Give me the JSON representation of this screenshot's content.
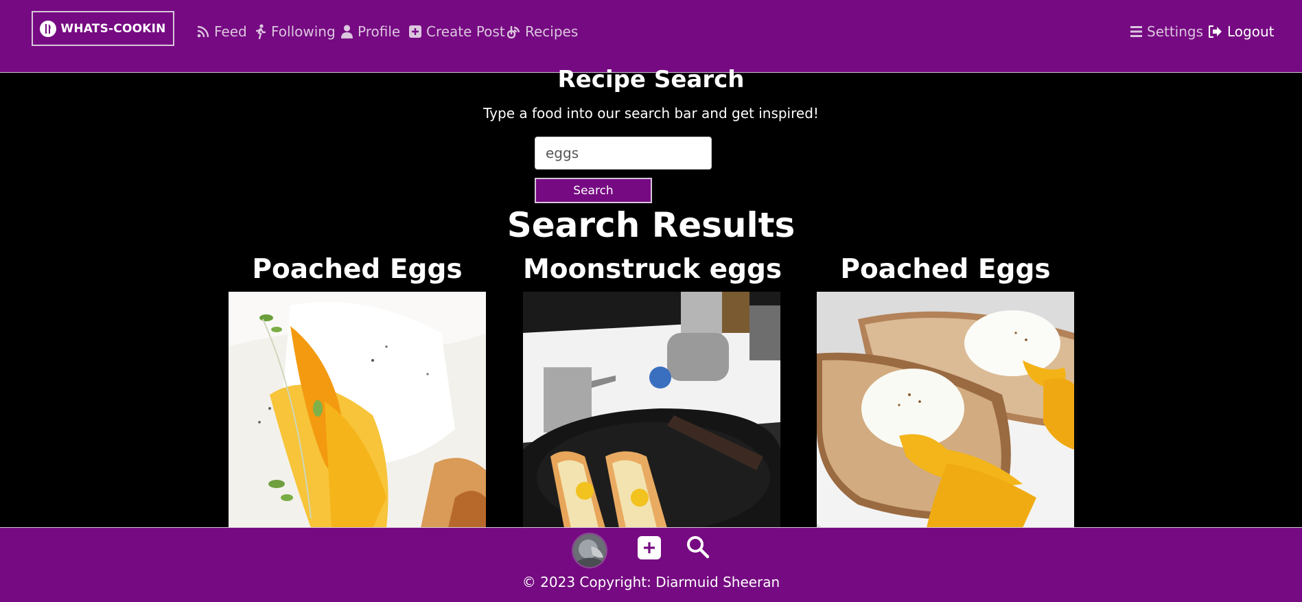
{
  "navbar": {
    "brand": "WHATS-COOKIN",
    "links": [
      {
        "label": "Feed",
        "icon": "rss-icon"
      },
      {
        "label": "Following",
        "icon": "walking-icon"
      },
      {
        "label": "Profile",
        "icon": "user-icon"
      },
      {
        "label": "Create Post",
        "icon": "plus-square-icon"
      },
      {
        "label": "Recipes",
        "icon": "blog-icon"
      }
    ],
    "settings_label": "Settings",
    "logout_label": "Logout"
  },
  "search": {
    "title": "Recipe Search",
    "subtitle": "Type a food into our search bar and get inspired!",
    "value": "eggs",
    "button_label": "Search"
  },
  "results": {
    "title": "Search Results",
    "items": [
      {
        "title": "Poached Eggs"
      },
      {
        "title": "Moonstruck eggs"
      },
      {
        "title": "Poached Eggs"
      }
    ]
  },
  "footer": {
    "copyright": "© 2023 Copyright: Diarmuid Sheeran"
  },
  "colors": {
    "brand_purple": "#760a82",
    "background": "#000000",
    "nav_text": "#dcc6df"
  }
}
